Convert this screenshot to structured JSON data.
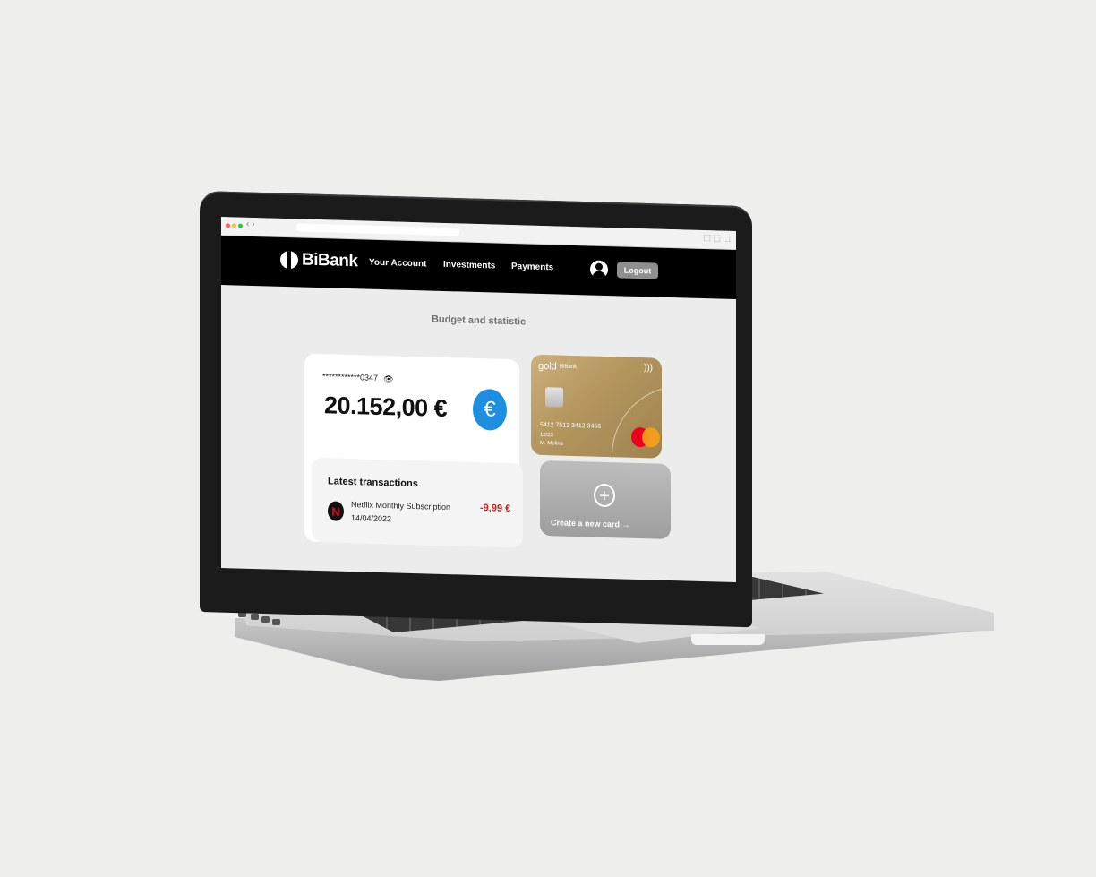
{
  "site": {
    "brand": "BiBank",
    "nav": [
      "Your Account",
      "Investments",
      "Payments"
    ],
    "logout_label": "Logout"
  },
  "page": {
    "title": "Budget and statistic"
  },
  "account": {
    "masked_number": "************0347",
    "balance": "20.152,00 €",
    "currency_symbol": "€"
  },
  "transactions": {
    "title": "Latest transactions",
    "items": [
      {
        "description": "Netflix Monthly Subscription",
        "date": "14/04/2022",
        "amount": "-9,99 €",
        "icon": "N"
      }
    ]
  },
  "card": {
    "tier": "gold",
    "brand": "BiBank",
    "number": "5412 7512 3412 3456",
    "expiry": "12/23",
    "holder": "M. Molina"
  },
  "new_card": {
    "label": "Create a new card →"
  },
  "colors": {
    "accent_blue": "#1e8fe0",
    "negative": "#e11b1b",
    "nav_bg": "#000000"
  }
}
